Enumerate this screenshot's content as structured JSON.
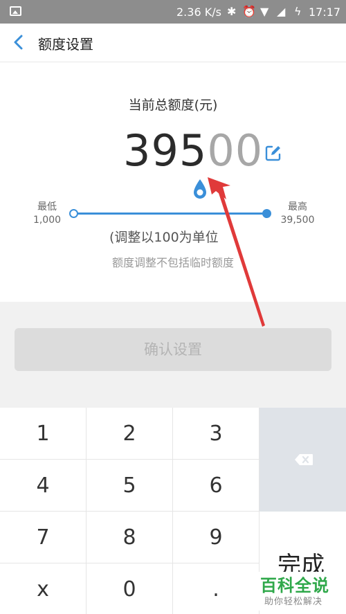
{
  "status_bar": {
    "speed": "2.36 K/s",
    "time": "17:17"
  },
  "header": {
    "title": "额度设置"
  },
  "main": {
    "total_label": "当前总额度(元)",
    "amount_prefix": "395",
    "amount_suffix": "00",
    "min_title": "最低",
    "min_value": "1,000",
    "max_title": "最高",
    "max_value": "39,500",
    "slider_level": 1.0,
    "unit_note": "(调整以100为单位",
    "temp_note": "额度调整不包括临时额度"
  },
  "confirm_button": "确认设置",
  "keypad": {
    "keys": [
      "1",
      "2",
      "3",
      "4",
      "5",
      "6",
      "7",
      "8",
      "9",
      "x",
      "0",
      "."
    ],
    "done": "完成"
  },
  "watermark": {
    "main": "百科全说",
    "sub": "助你轻松解决"
  },
  "colors": {
    "accent": "#3a8fd9",
    "annotation_arrow": "#e03a3a",
    "watermark": "#2fa84a"
  }
}
